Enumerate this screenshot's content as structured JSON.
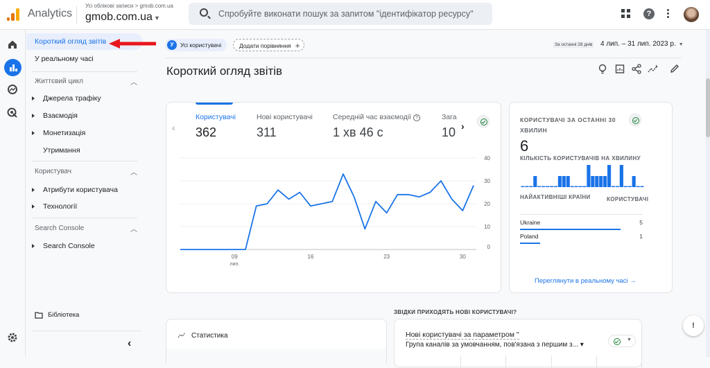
{
  "header": {
    "app_name": "Analytics",
    "breadcrumb": "Усі облікові записи > gmob.com.ua",
    "account": "gmob.com.ua",
    "search_placeholder": "Спробуйте виконати пошук за запитом \"ідентифікатор ресурсу\"",
    "help_glyph": "?"
  },
  "rail": {
    "icons": [
      "home-icon",
      "reports-icon",
      "explore-icon",
      "advertising-icon",
      "settings-icon"
    ]
  },
  "sidebar": {
    "top_items": [
      {
        "label": "Короткий огляд звітів",
        "selected": true
      },
      {
        "label": "У реальному часі",
        "selected": false
      }
    ],
    "groups": [
      {
        "title": "Життєвий цикл",
        "items": [
          {
            "label": "Джерела трафіку",
            "expandable": true
          },
          {
            "label": "Взаємодія",
            "expandable": true
          },
          {
            "label": "Монетизація",
            "expandable": true
          },
          {
            "label": "Утримання",
            "expandable": false
          }
        ]
      },
      {
        "title": "Користувач",
        "items": [
          {
            "label": "Атрибути користувача",
            "expandable": true
          },
          {
            "label": "Технології",
            "expandable": true
          }
        ]
      },
      {
        "title": "Search Console",
        "items": [
          {
            "label": "Search Console",
            "expandable": true
          }
        ]
      }
    ],
    "library": "Бібліотека",
    "collapse_glyph": "‹"
  },
  "main": {
    "segment_chip": "Усі користувачі",
    "segment_letter": "У",
    "compare_button": "Додати порівняння",
    "date_range_badge": "За останні 28 днів",
    "date_range": "4 лип. – 31 лип. 2023 р.",
    "page_title": "Короткий огляд звітів",
    "metrics": [
      {
        "label": "Користувачі",
        "value": "362",
        "active": true
      },
      {
        "label": "Нові користувачі",
        "value": "311",
        "active": false
      },
      {
        "label": "Середній час взаємодії",
        "value": "1 хв 46 с",
        "active": false
      },
      {
        "label": "Зага",
        "value": "10",
        "active": false
      }
    ]
  },
  "chart_data": [
    {
      "type": "line",
      "title": "Користувачі",
      "x": [
        "04",
        "05",
        "06",
        "07",
        "08",
        "09",
        "10",
        "11",
        "12",
        "13",
        "14",
        "15",
        "16",
        "17",
        "18",
        "19",
        "20",
        "21",
        "22",
        "23",
        "24",
        "25",
        "26",
        "27",
        "28",
        "29",
        "30",
        "31"
      ],
      "series": [
        {
          "name": "Користувачі",
          "color": "#1a73e8",
          "values": [
            0,
            0,
            0,
            0,
            0,
            0,
            0,
            19,
            20,
            26,
            22,
            25,
            19,
            20,
            21,
            33,
            23,
            9,
            21,
            16,
            24,
            24,
            23,
            25,
            30,
            22,
            17,
            28
          ]
        }
      ],
      "x_tick_labels": [
        {
          "x": "09",
          "label": "09",
          "sublabel": "лип."
        },
        {
          "x": "16",
          "label": "16"
        },
        {
          "x": "23",
          "label": "23"
        },
        {
          "x": "30",
          "label": "30"
        }
      ],
      "y_ticks": [
        0,
        10,
        20,
        30,
        40
      ],
      "ylim": [
        0,
        40
      ],
      "grid": true
    },
    {
      "type": "bar",
      "title": "Кількість користувачів на хвилину",
      "values": [
        0,
        0,
        0,
        1,
        0,
        0,
        0,
        0,
        0,
        1,
        1,
        1,
        0,
        0,
        0,
        0,
        2,
        1,
        1,
        1,
        1,
        2,
        0,
        0,
        2,
        0,
        0,
        1,
        0,
        0
      ],
      "color": "#1a73e8"
    }
  ],
  "realtime": {
    "title": "КОРИСТУВАЧІ ЗА ОСТАННІ 30 ХВИЛИН",
    "count": "6",
    "per_minute_label": "КІЛЬКІСТЬ КОРИСТУВАЧІВ НА ХВИЛИНУ",
    "col_country": "НАЙАКТИВНІШІ КРАЇНИ",
    "col_users": "КОРИСТУВАЧІ",
    "rows": [
      {
        "country": "Ukraine",
        "users": "5",
        "share": 1.0
      },
      {
        "country": "Poland",
        "users": "1",
        "share": 0.2
      }
    ],
    "link": "Переглянути в реальному часі →"
  },
  "stats_card": {
    "title": "Статистика"
  },
  "sources": {
    "heading": "ЗВІДКИ ПРИХОДЯТЬ НОВІ КОРИСТУВАЧІ?",
    "title": "Нові користувачі за параметром \"",
    "dimension": "Група каналів за умовчанням, пов'язана з першим з... ▾"
  }
}
